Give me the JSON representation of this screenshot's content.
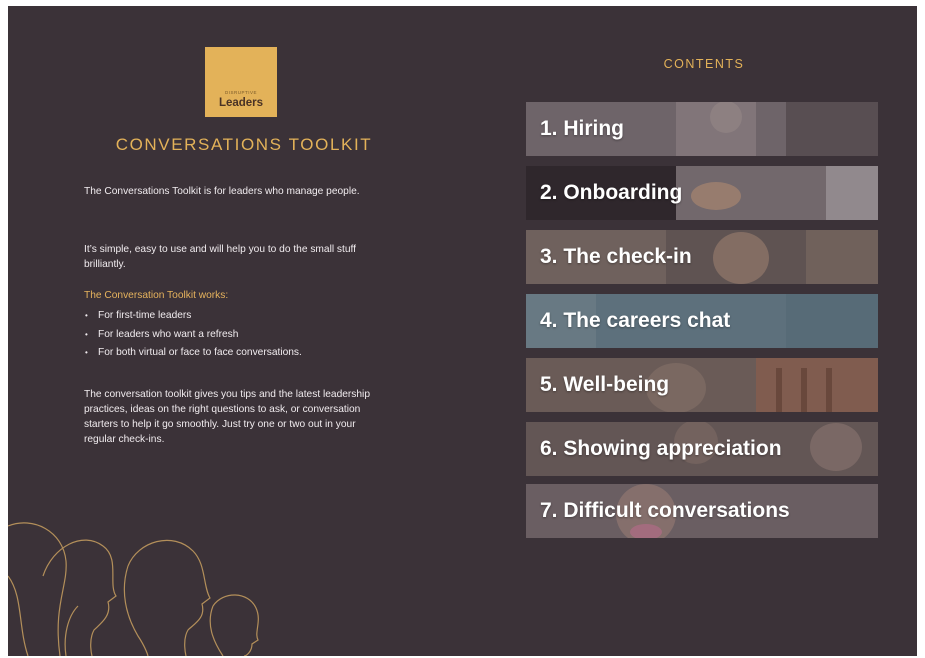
{
  "logo": {
    "small_text": "DISRUPTIVE",
    "main_text": "Leaders"
  },
  "left": {
    "title": "CONVERSATIONS TOOLKIT",
    "para1": "The Conversations Toolkit is for leaders who manage people.",
    "para2": "It’s simple, easy to use and will help you to do the small stuff brilliantly.",
    "works_heading": "The Conversation Toolkit works:",
    "bullets": [
      "For first-time leaders",
      "For leaders who want a refresh",
      "For both virtual or face to face conversations."
    ],
    "para3": "The conversation toolkit gives you tips and the latest leadership practices, ideas on the right questions to ask, or conversation starters to help it go smoothly. Just try one or two out in your regular check-ins."
  },
  "contents": {
    "title": "CONTENTS",
    "items": [
      {
        "label": "1. Hiring",
        "bg": "#6e6469"
      },
      {
        "label": "2. Onboarding",
        "bg": "#5b5156"
      },
      {
        "label": "3. The check-in",
        "bg": "#6a5d5c"
      },
      {
        "label": "4. The careers chat",
        "bg": "#5e727e"
      },
      {
        "label": "5. Well-being",
        "bg": "#6d5c57"
      },
      {
        "label": "6. Showing appreciation",
        "bg": "#665a59"
      },
      {
        "label": "7. Difficult conversations",
        "bg": "#6a5e62"
      }
    ]
  },
  "colors": {
    "background": "#3b3238",
    "accent": "#e3b259",
    "text": "#f1ecef"
  }
}
